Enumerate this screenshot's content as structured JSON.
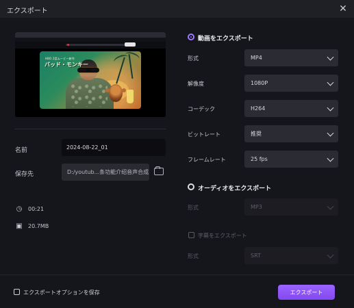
{
  "window": {
    "title": "エクスポート"
  },
  "preview": {
    "poster_top_text": "HBO 2話ムービー新作",
    "poster_title": "バッド・モンキー"
  },
  "left_panel": {
    "name_label": "名前",
    "name_value": "2024-08-22_01",
    "save_label": "保存先",
    "save_path": "D:/youtub...条功能介绍音声合成",
    "duration": "00:21",
    "file_size": "20.7MB"
  },
  "video_export": {
    "title": "動画をエクスポート",
    "format_label": "形式",
    "format_value": "MP4",
    "resolution_label": "解像度",
    "resolution_value": "1080P",
    "codec_label": "コーデック",
    "codec_value": "H264",
    "bitrate_label": "ビットレート",
    "bitrate_value": "推奨",
    "framerate_label": "フレームレート",
    "framerate_value": "25  fps"
  },
  "audio_export": {
    "title": "オーディオをエクスポート",
    "format_label": "形式",
    "format_value": "MP3"
  },
  "subtitle_export": {
    "checkbox_label": "字幕をエクスポート",
    "format_label": "形式",
    "format_value": "SRT"
  },
  "footer": {
    "save_options_label": "エクスポートオプションを保存",
    "export_button": "エクスポート"
  },
  "colors": {
    "accent": "#8d57ff",
    "background": "#15151c"
  },
  "icons": {
    "close": "close-icon",
    "folder": "folder-icon",
    "duration": "clock-icon",
    "size": "save-icon"
  }
}
